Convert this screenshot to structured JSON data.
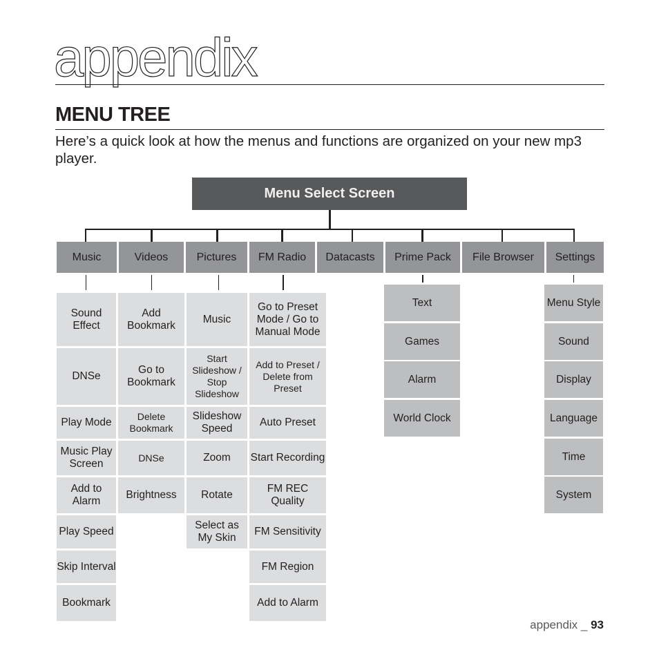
{
  "page": {
    "chapter_title": "appendix",
    "section_title": "MENU TREE",
    "intro": "Here’s a quick look at how the menus and functions are organized on your new mp3 player.",
    "footer_label": "appendix _ ",
    "page_number": "93"
  },
  "tree": {
    "root": "Menu Select Screen",
    "categories": [
      {
        "label": "Music",
        "items": [
          "Sound Effect",
          "DNSe",
          "Play Mode",
          "Music Play Screen",
          "Add to Alarm",
          "Play Speed",
          "Skip Interval",
          "Bookmark"
        ]
      },
      {
        "label": "Videos",
        "items": [
          "Add Bookmark",
          "Go to Bookmark",
          "Delete Bookmark",
          "DNSe",
          "Brightness"
        ]
      },
      {
        "label": "Pictures",
        "items": [
          "Music",
          "Start Slideshow / Stop Slideshow",
          "Slideshow Speed",
          "Zoom",
          "Rotate",
          "Select as My Skin"
        ]
      },
      {
        "label": "FM Radio",
        "items": [
          "Go to Preset Mode / Go to Manual Mode",
          "Add to Preset / Delete from Preset",
          "Auto Preset",
          "Start Recording",
          "FM REC Quality",
          "FM Sensitivity",
          "FM Region",
          "Add to Alarm"
        ]
      },
      {
        "label": "Datacasts",
        "items": []
      },
      {
        "label": "Prime Pack",
        "items": [
          "Text",
          "Games",
          "Alarm",
          "World Clock"
        ]
      },
      {
        "label": "File Browser",
        "items": []
      },
      {
        "label": "Settings",
        "items": [
          "Menu Style",
          "Sound",
          "Display",
          "Language",
          "Time",
          "System"
        ]
      }
    ]
  },
  "colors": {
    "root_bg": "#58595b",
    "category_bg": "#939598",
    "item_bg": "#dcddde",
    "item_bg_dark": "#bcbec0",
    "text": "#231f20"
  }
}
